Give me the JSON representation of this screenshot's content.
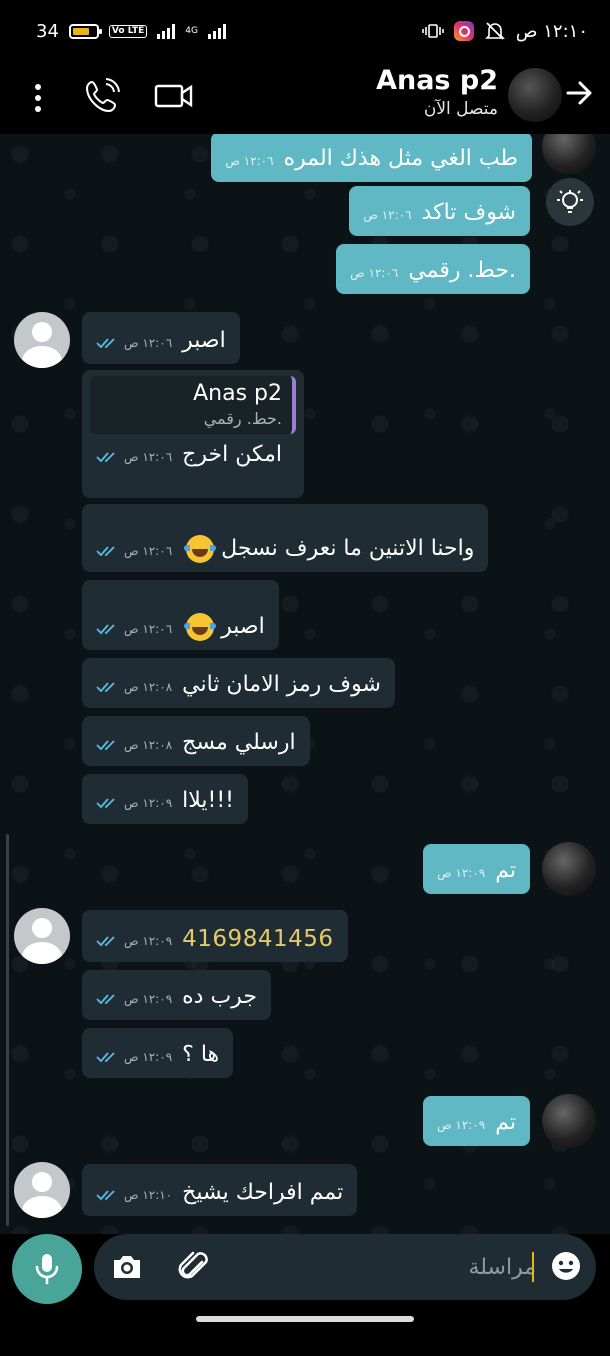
{
  "status_bar": {
    "signal_left": "34",
    "volte": "Vo LTE",
    "network": "4G",
    "time": "١٢:١٠ ص"
  },
  "header": {
    "contact_name": "Anas p2",
    "status": "متصل الآن"
  },
  "messages": [
    {
      "id": "m1",
      "direction": "out",
      "text": "طب الغي مثل هذك المره",
      "time": "١٢:٠٦ ص"
    },
    {
      "id": "m2",
      "direction": "out",
      "text": "شوف تاكد",
      "time": "١٢:٠٦ ص"
    },
    {
      "id": "m3",
      "direction": "out",
      "text": "حط. رقمي.",
      "time": "١٢:٠٦ ص"
    },
    {
      "id": "m4",
      "direction": "in",
      "text": "اصبر",
      "time": "١٢:٠٦ ص"
    },
    {
      "id": "m5",
      "direction": "in",
      "text": "امكن اخرج",
      "time": "١٢:٠٦ ص",
      "reply": {
        "name": "Anas p2",
        "text": "حط. رقمي."
      }
    },
    {
      "id": "m6",
      "direction": "in",
      "text": "واحنا الاتنين ما نعرف نسجل",
      "time": "١٢:٠٦ ص",
      "emoji": "tears-of-joy-emoji"
    },
    {
      "id": "m7",
      "direction": "in",
      "text": "اصبر",
      "time": "١٢:٠٦ ص",
      "emoji": "tears-of-joy-emoji"
    },
    {
      "id": "m8",
      "direction": "in",
      "text": "شوف رمز الامان ثاني",
      "time": "١٢:٠٨ ص"
    },
    {
      "id": "m9",
      "direction": "in",
      "text": "ارسلي مسج",
      "time": "١٢:٠٨ ص"
    },
    {
      "id": "m10",
      "direction": "in",
      "text": "يلاا!!!",
      "time": "١٢:٠٩ ص"
    },
    {
      "id": "m11",
      "direction": "out",
      "text": "تم",
      "time": "١٢:٠٩ ص"
    },
    {
      "id": "m12",
      "direction": "in",
      "text": "4169841456",
      "time": "١٢:٠٩ ص"
    },
    {
      "id": "m13",
      "direction": "in",
      "text": "جرب ده",
      "time": "١٢:٠٩ ص"
    },
    {
      "id": "m14",
      "direction": "in",
      "text": "ها ؟",
      "time": "١٢:٠٩ ص"
    },
    {
      "id": "m15",
      "direction": "out",
      "text": "تم",
      "time": "١٢:٠٩ ص"
    },
    {
      "id": "m16",
      "direction": "in",
      "text": "تمم افراحك يشيخ",
      "time": "١٢:١٠ ص"
    }
  ],
  "input": {
    "placeholder": "مراسلة"
  },
  "colors": {
    "outgoing_bubble": "#5fb8c4",
    "incoming_bubble": "#1f2c33",
    "chat_background": "#0c1317",
    "mic_button": "#49a59a",
    "read_ticks": "#53bdeb"
  }
}
